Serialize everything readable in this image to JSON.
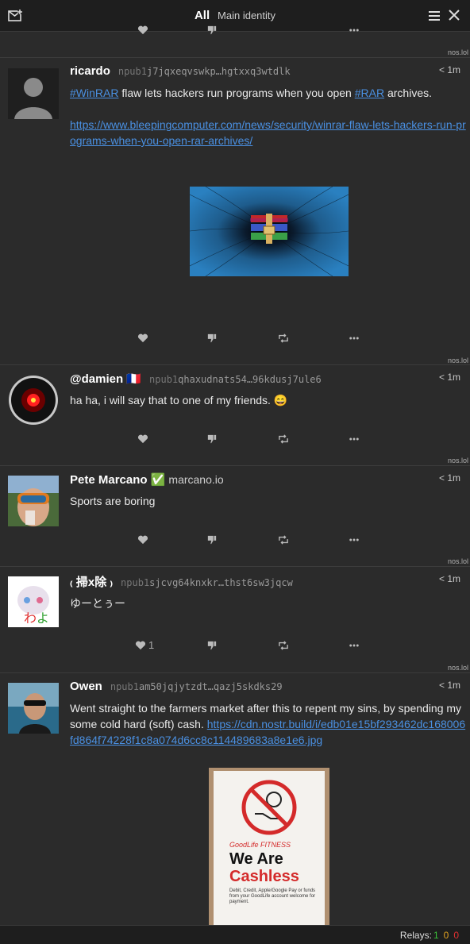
{
  "header": {
    "tab_all": "All",
    "tab_identity": "Main identity"
  },
  "posts": [
    {
      "relay": "nos.lol",
      "name": "ricardo",
      "npub_prefix": "npub1",
      "npub_rest": "j7jqxeqvswkp…hgtxxq3wtdlk",
      "time": "< 1m",
      "hashtag1": "#WinRAR",
      "text1": " flaw lets hackers run programs when you open ",
      "hashtag2": "#RAR",
      "text2": " archives.",
      "link": "https://www.bleepingcomputer.com/news/security/winrar-flaw-lets-hackers-run-programs-when-you-open-rar-archives/"
    },
    {
      "relay": "nos.lol",
      "name": "@damien",
      "flag": "🇫🇷",
      "npub_prefix": "npub1",
      "npub_rest": "qhaxudnats54…96kdusj7ule6",
      "time": "< 1m",
      "text": "ha ha, i will say that to one of my friends. 😄"
    },
    {
      "relay": "nos.lol",
      "name": "Pete Marcano",
      "verified": "✅",
      "nip05": "marcano.io",
      "time": "< 1m",
      "text": "Sports are boring"
    },
    {
      "relay": "nos.lol",
      "name": "₍ 掃x除 ₎",
      "npub_prefix": "npub1",
      "npub_rest": "sjcvg64knxkr…thst6sw3jqcw",
      "time": "< 1m",
      "text": "ゆーとぅー",
      "like_count": "1"
    },
    {
      "relay": "nos.lol",
      "name": "Owen",
      "npub_prefix": "npub1",
      "npub_rest": "am50jqjytzdt…qazj5skdks29",
      "time": "< 1m",
      "text": "Went straight to the farmers market after this to repent my sins, by spending my some cold hard (soft) cash. ",
      "link": "https://cdn.nostr.build/i/edb01e15bf293462dc168006fd864f74228f1c8a074d6cc8c114489683a8e1e6.jpg",
      "sign": {
        "brand": "GoodLife FITNESS",
        "line1": "We Are",
        "line2": "Cashless",
        "small": "Debit, Credit, Apple/Google Pay or funds from your GoodLife account welcome for payment."
      }
    }
  ],
  "status": {
    "label": "Relays:",
    "green": "1",
    "yellow": "0",
    "red": "0"
  },
  "colors": {
    "accent_link": "#4a90e2",
    "bg": "#2b2b2b",
    "bar": "#1e1e1e"
  }
}
